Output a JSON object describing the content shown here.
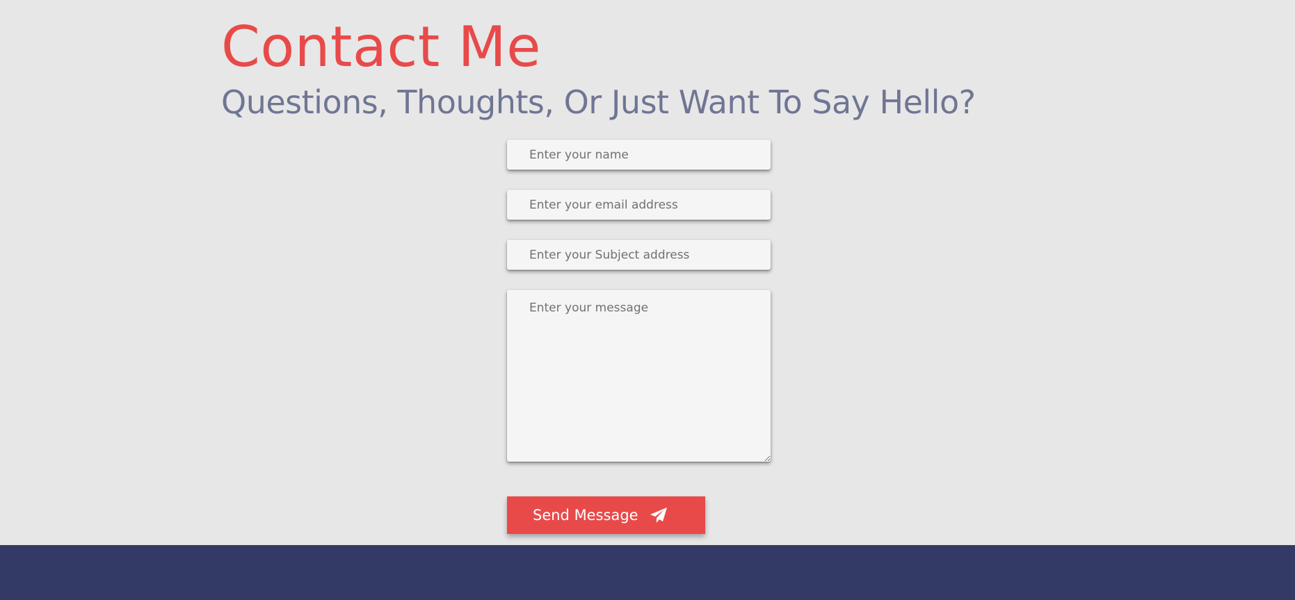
{
  "header": {
    "title": "Contact Me",
    "subtitle": "Questions, Thoughts, Or Just Want To Say Hello?"
  },
  "form": {
    "name_placeholder": "Enter your name",
    "email_placeholder": "Enter your email address",
    "subject_placeholder": "Enter your Subject address",
    "message_placeholder": "Enter your message",
    "send_label": "Send Message",
    "send_icon": "paper-plane-icon"
  },
  "colors": {
    "accent": "#e84a4a",
    "subtitle": "#6f7694",
    "background": "#e7e7e7",
    "footer": "#343a66"
  }
}
